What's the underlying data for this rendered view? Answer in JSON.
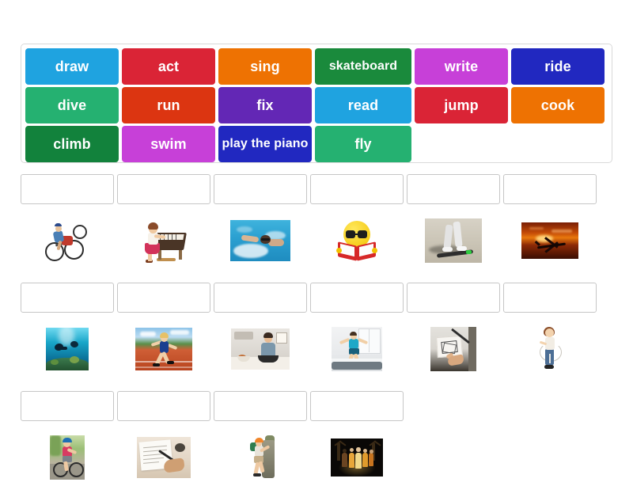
{
  "activity": {
    "type": "match-up",
    "title": "Match up activity"
  },
  "word_bank": {
    "rows": [
      [
        {
          "label": "draw",
          "color": "#1fa3e0"
        },
        {
          "label": "act",
          "color": "#da2436"
        },
        {
          "label": "sing",
          "color": "#ee7202"
        },
        {
          "label": "skateboard",
          "color": "#1a8a3c"
        },
        {
          "label": "write",
          "color": "#c740d8"
        },
        {
          "label": "ride",
          "color": "#2128c0"
        }
      ],
      [
        {
          "label": "dive",
          "color": "#25b171"
        },
        {
          "label": "run",
          "color": "#dc3511"
        },
        {
          "label": "fix",
          "color": "#6327b5"
        },
        {
          "label": "read",
          "color": "#1fa3e0"
        },
        {
          "label": "jump",
          "color": "#da2436"
        },
        {
          "label": "cook",
          "color": "#ee7202"
        }
      ],
      [
        {
          "label": "climb",
          "color": "#12823c"
        },
        {
          "label": "swim",
          "color": "#c740d8"
        },
        {
          "label": "play the piano",
          "color": "#2128c0"
        },
        {
          "label": "fly",
          "color": "#25b171"
        }
      ]
    ]
  },
  "answer_grid": {
    "rows": [
      [
        {
          "drop_value": "",
          "image": "ride-bicycles-children"
        },
        {
          "drop_value": "",
          "image": "play-the-piano-girl"
        },
        {
          "drop_value": "",
          "image": "swim-butterfly-stroke"
        },
        {
          "drop_value": "",
          "image": "read-smiley-book"
        },
        {
          "drop_value": "",
          "image": "skateboard-legs"
        },
        {
          "drop_value": "",
          "image": "fly-airplane-sunset"
        }
      ],
      [
        {
          "drop_value": "",
          "image": "dive-scuba-divers"
        },
        {
          "drop_value": "",
          "image": "run-athlete-track"
        },
        {
          "drop_value": "",
          "image": "cook-woman-kitchen"
        },
        {
          "drop_value": "",
          "image": "jump-boy-on-bed"
        },
        {
          "drop_value": "",
          "image": "draw-hand-pencil"
        },
        {
          "drop_value": "",
          "image": "skip-rope-girl"
        }
      ],
      [
        {
          "drop_value": "",
          "image": "ride-bicycle-woman"
        },
        {
          "drop_value": "",
          "image": "write-hand-notebook"
        },
        {
          "drop_value": "",
          "image": "climb-rock-climber"
        },
        {
          "drop_value": "",
          "image": "act-stage-performance"
        }
      ]
    ]
  },
  "colors": {
    "page_background": "#ffffff",
    "panel_border": "#d9d9d9",
    "dropbox_border": "#c6c6c6",
    "tile_text": "#ffffff"
  }
}
